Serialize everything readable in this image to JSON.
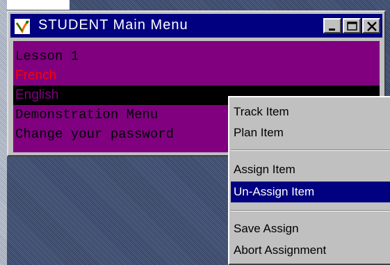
{
  "window": {
    "title": "STUDENT  Main  Menu",
    "icon": "app-leaf-icon",
    "controls": [
      "minimize-icon",
      "maximize-icon",
      "close-icon"
    ]
  },
  "menu": {
    "items": [
      {
        "label": "Lesson 1",
        "state": "normal"
      },
      {
        "label": "French",
        "state": "highlight"
      },
      {
        "label": "English",
        "state": "selected"
      },
      {
        "label": "Demonstration Menu",
        "state": "normal"
      },
      {
        "label": "Change your password",
        "state": "normal"
      }
    ]
  },
  "context_menu": {
    "groups": [
      [
        "Track Item",
        "Plan Item"
      ],
      [
        "Assign Item",
        "Un-Assign Item"
      ],
      [
        "Save Assign",
        "Abort Assignment"
      ]
    ],
    "active": "Un-Assign Item"
  },
  "colors": {
    "title_bar": "#000080",
    "menu_bg": "#800080",
    "highlight_text": "#ff0000",
    "selected_bg": "#000000",
    "context_active": "#000080",
    "desktop": "#3b4a6a"
  }
}
